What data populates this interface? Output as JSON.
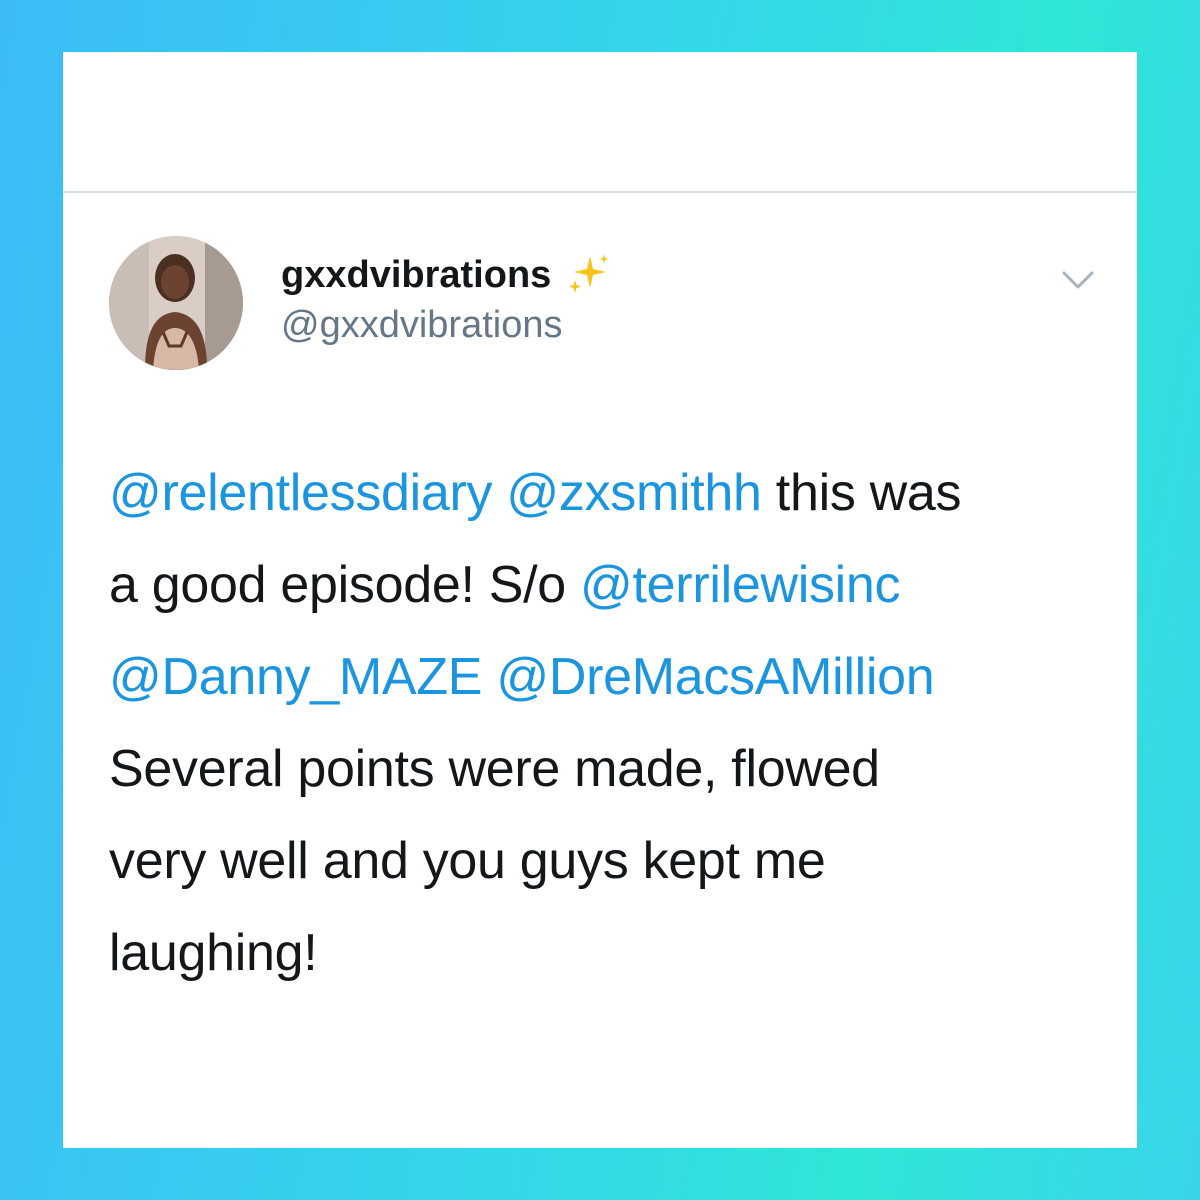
{
  "tweet": {
    "author": {
      "display_name": "gxxdvibrations",
      "handle": "@gxxdvibrations",
      "badge_icon": "sparkles-icon"
    },
    "menu_icon": "chevron-down-icon",
    "text_lines": [
      [
        "@relentlessdiary",
        " ",
        "@zxsmithh",
        " this was"
      ],
      [
        "a good episode! S/o ",
        "@terrilewisinc"
      ],
      [
        "@Danny_MAZE",
        " ",
        "@DreMacsAMillion"
      ],
      [
        "Several points were made, flowed"
      ],
      [
        "very well and you guys kept me"
      ],
      [
        "laughing!"
      ]
    ]
  },
  "colors": {
    "mention": "#1b95e0",
    "text": "#14171a",
    "handle": "#657786",
    "background_gradient": [
      "#3bbcf6",
      "#2ee6d6"
    ]
  }
}
